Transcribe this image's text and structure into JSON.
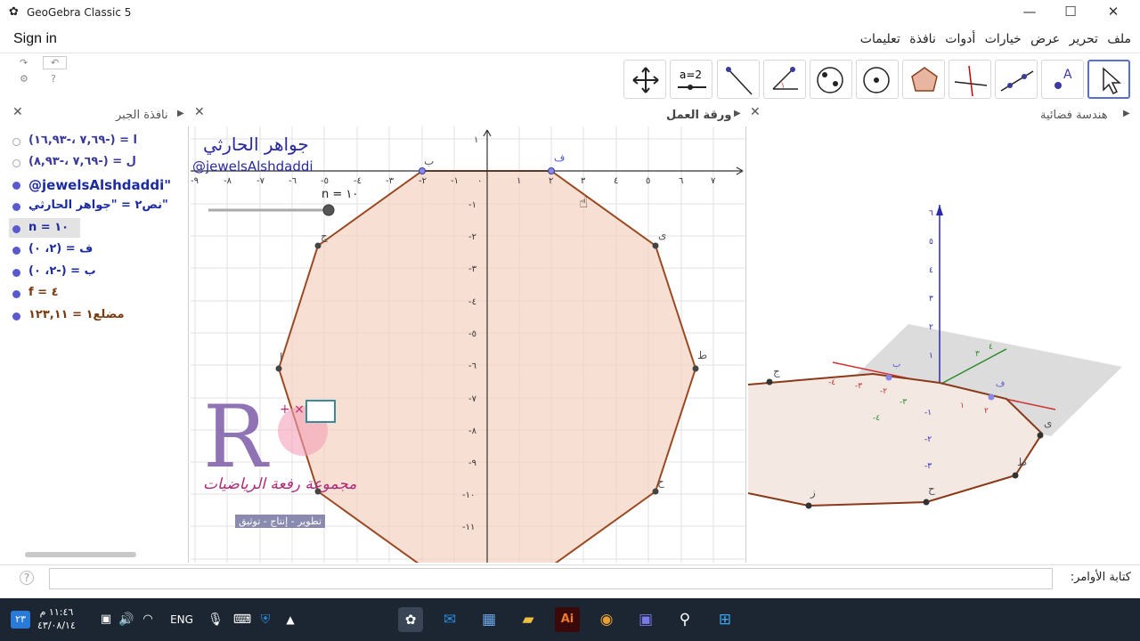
{
  "window": {
    "title": "GeoGebra Classic 5",
    "minimize": "—",
    "maximize": "☐",
    "close": "✕"
  },
  "menubar": {
    "sign_in": "Sign in",
    "menus": [
      "ملف",
      "تحرير",
      "عرض",
      "خيارات",
      "أدوات",
      "نافذة",
      "تعليمات"
    ]
  },
  "toolbar": {
    "tools": [
      "move",
      "point",
      "line",
      "perpendicular",
      "polygon",
      "circle",
      "conic",
      "angle",
      "reflect",
      "slider",
      "move-view"
    ],
    "slider_label": "a=2"
  },
  "algebra": {
    "title": "نافذة الجبر",
    "items": [
      {
        "text": "ا = (-٧,٦٩ ،-١٦,٩٣)",
        "color": "#3a3a9a",
        "visible": false
      },
      {
        "text": "ل = (-٧,٦٩ ،-٨,٩٣)",
        "color": "#3a3a9a",
        "visible": false
      },
      {
        "text": "@jewelsAlshdaddi\"",
        "color": "#1b2ba0",
        "visible": true
      },
      {
        "text": "نص٢ = \"جواهر الحارثي\"",
        "color": "#1b2ba0",
        "visible": true
      },
      {
        "text": "n = ١٠",
        "color": "#1b2ba0",
        "visible": true
      },
      {
        "text": "ف = (٢، ٠)",
        "color": "#1b2ba0",
        "visible": true
      },
      {
        "text": "ب = (-٢، ٠)",
        "color": "#1b2ba0",
        "visible": true
      },
      {
        "text": "f = ٤",
        "color": "#7a3a10",
        "visible": true
      },
      {
        "text": "مضلع١ = ١٢٣,١١",
        "color": "#7a3a10",
        "visible": true
      }
    ]
  },
  "graphics": {
    "title": "ورقة العمل",
    "name_ar": "جواهر الحارثي",
    "handle": "@jewelsAlshdaddi",
    "slider_text": "n = ١٠",
    "watermark_title": "مجموعة رفعة الرياضيات",
    "watermark_tag": "تطوير - إنتاج - توثيق",
    "point_labels": [
      "ب",
      "ف",
      "ى",
      "ط",
      "ح",
      "ج",
      "ا"
    ]
  },
  "graphics3d": {
    "title": "هندسة فضائية",
    "labels": [
      "ج",
      "ى",
      "ط",
      "ح",
      "ز",
      "ف",
      "ب"
    ]
  },
  "inputbar": {
    "label": "كتابة الأوامر:"
  },
  "taskbar": {
    "time": "١١:٤٦ م",
    "date": "٤٣/٠٨/١٤",
    "lang": "ENG",
    "badge": "٢٣"
  }
}
